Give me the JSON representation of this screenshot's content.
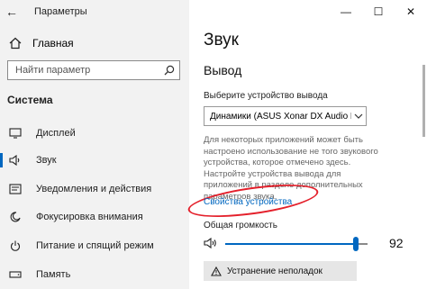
{
  "window": {
    "title": "Параметры",
    "minimize": "—",
    "maximize": "☐",
    "close": "✕"
  },
  "sidebar": {
    "home_label": "Главная",
    "search_placeholder": "Найти параметр",
    "section_title": "Система",
    "items": [
      {
        "label": "Дисплей",
        "icon": "display-icon"
      },
      {
        "label": "Звук",
        "icon": "speaker-icon",
        "active": true
      },
      {
        "label": "Уведомления и действия",
        "icon": "notifications-icon"
      },
      {
        "label": "Фокусировка внимания",
        "icon": "focus-moon-icon"
      },
      {
        "label": "Питание и спящий режим",
        "icon": "power-icon"
      },
      {
        "label": "Память",
        "icon": "storage-icon"
      }
    ]
  },
  "main": {
    "page_title": "Звук",
    "section_title": "Вывод",
    "output_device_label": "Выберите устройство вывода",
    "output_device_value": "Динамики (ASUS Xonar DX Audio D...",
    "info_text": "Для некоторых приложений может быть настроено использование не того звукового устройства, которое отмечено здесь. Настройте устройства вывода для приложений в разделе дополнительных параметров звука.",
    "device_properties_link": "Свойства устройства",
    "volume_label": "Общая громкость",
    "volume_value": "92",
    "volume_level": 0.92,
    "troubleshoot_label": "Устранение неполадок"
  },
  "colors": {
    "accent": "#0067c0",
    "highlight": "#e4202b",
    "sidebar_bg": "#f2f2f2"
  }
}
